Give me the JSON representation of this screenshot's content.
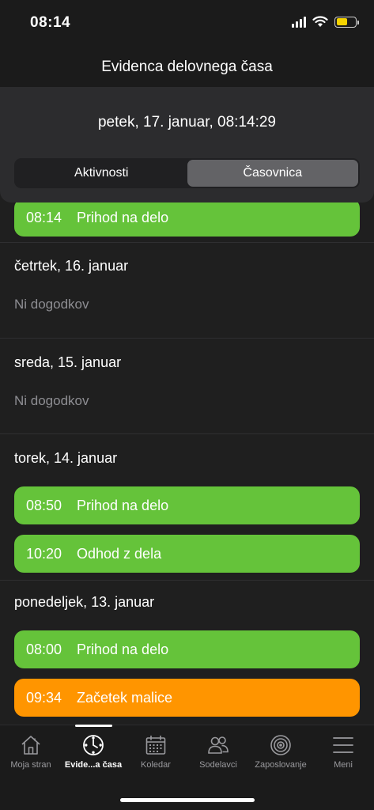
{
  "status": {
    "time": "08:14"
  },
  "nav": {
    "title": "Evidenca delovnega časa"
  },
  "header": {
    "datetime": "petek, 17. januar, 08:14:29",
    "segments": [
      "Aktivnosti",
      "Časovnica"
    ],
    "selected_segment": "Časovnica"
  },
  "timeline": {
    "top_event": {
      "time": "08:14",
      "label": "Prihod na delo",
      "color": "#65c33a"
    },
    "days": [
      {
        "date": "četrtek, 16. januar",
        "empty_text": "Ni dogodkov",
        "events": []
      },
      {
        "date": "sreda, 15. januar",
        "empty_text": "Ni dogodkov",
        "events": []
      },
      {
        "date": "torek, 14. januar",
        "events": [
          {
            "time": "08:50",
            "label": "Prihod na delo",
            "color": "#65c33a"
          },
          {
            "time": "10:20",
            "label": "Odhod z dela",
            "color": "#65c33a"
          }
        ]
      },
      {
        "date": "ponedeljek, 13. januar",
        "events": [
          {
            "time": "08:00",
            "label": "Prihod na delo",
            "color": "#65c33a"
          },
          {
            "time": "09:34",
            "label": "Začetek malice",
            "color": "#ff9500"
          }
        ]
      }
    ]
  },
  "tabbar": {
    "tabs": [
      {
        "label": "Moja stran",
        "icon": "home-icon"
      },
      {
        "label": "Evide...a časa",
        "icon": "clock-icon",
        "active": true
      },
      {
        "label": "Koledar",
        "icon": "calendar-icon"
      },
      {
        "label": "Sodelavci",
        "icon": "people-icon"
      },
      {
        "label": "Zaposlovanje",
        "icon": "target-icon"
      },
      {
        "label": "Meni",
        "icon": "menu-icon"
      }
    ]
  }
}
